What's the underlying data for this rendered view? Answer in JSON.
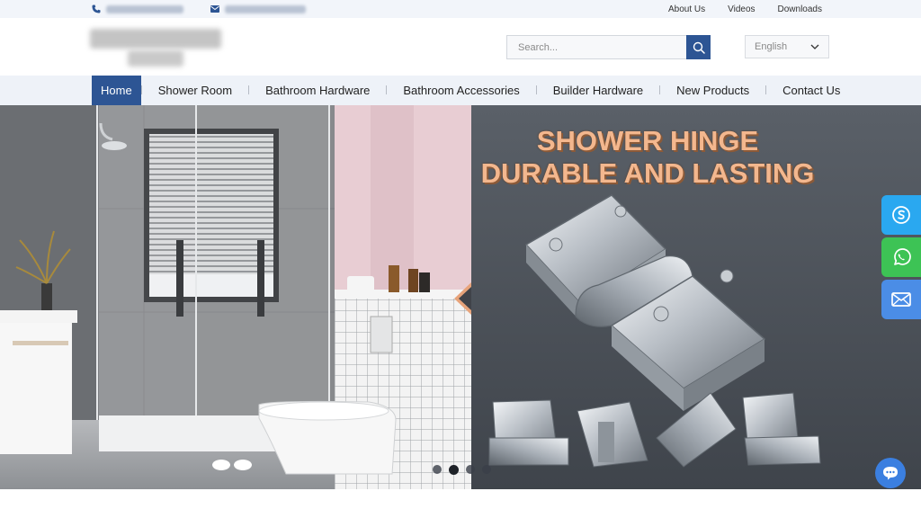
{
  "topbar": {
    "links": [
      "About Us",
      "Videos",
      "Downloads"
    ]
  },
  "header": {
    "search_placeholder": "Search...",
    "language": "English"
  },
  "nav": {
    "items": [
      "Home",
      "Shower Room",
      "Bathroom Hardware",
      "Bathroom Accessories",
      "Builder Hardware",
      "New Products",
      "Contact Us"
    ],
    "active": "Home"
  },
  "hero": {
    "line1": "SHOWER HINGE",
    "line2": "DURABLE AND LASTING",
    "slide_count": 4,
    "active_slide": 2
  },
  "colors": {
    "brand": "#2d5594",
    "skype": "#2aa8f0",
    "whatsapp": "#3dc355",
    "email": "#4b8de6"
  },
  "icons": [
    "phone-icon",
    "mail-icon",
    "search-icon",
    "chevron-down-icon",
    "skype-icon",
    "whatsapp-icon",
    "email-icon",
    "chat-icon"
  ]
}
